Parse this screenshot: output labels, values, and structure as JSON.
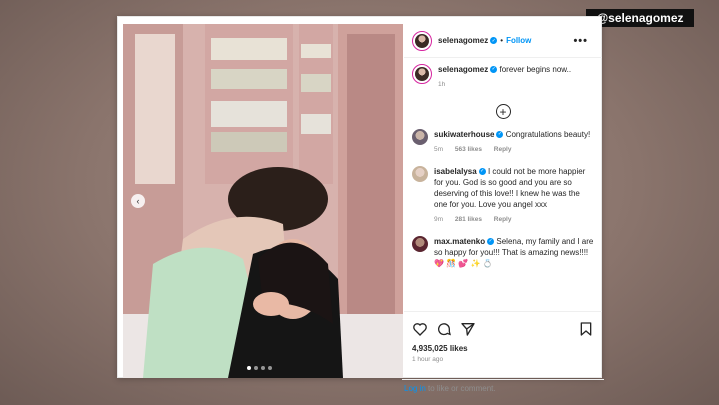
{
  "overlay": {
    "handle": "@selenagomez"
  },
  "post": {
    "username": "selenagomez",
    "follow_label": "Follow",
    "more_label": "•••",
    "caption_user": "selenagomez",
    "caption_text": "forever begins now..",
    "caption_time": "1h",
    "likes": "4,935,025 likes",
    "time_ago": "1 hour ago",
    "login_link": "Log in",
    "login_rest": " to like or comment."
  },
  "comments": [
    {
      "user": "sukiwaterhouse",
      "text": "Congratulations beauty!",
      "time": "5m",
      "likes": "563 likes",
      "reply": "Reply"
    },
    {
      "user": "isabelalysa",
      "text": "I could not be more happier for you. God is so good and you are so deserving of this love!! I knew he was the one for you. Love you angel xxx",
      "time": "9m",
      "likes": "281 likes",
      "reply": "Reply"
    },
    {
      "user": "max.matenko",
      "text": "Selena, my family and I are so happy for you!!! That is amazing news!!!! 💖 🎊 💕 ✨ 💍",
      "time": "",
      "likes": "",
      "reply": ""
    }
  ],
  "colors": {
    "accent": "#0095f6",
    "verified": "#0095f6"
  },
  "icons": [
    "verified-badge-icon",
    "more-options-icon",
    "add-comment-icon",
    "heart-icon",
    "comment-icon",
    "share-icon",
    "bookmark-icon",
    "previous-photo-icon"
  ]
}
